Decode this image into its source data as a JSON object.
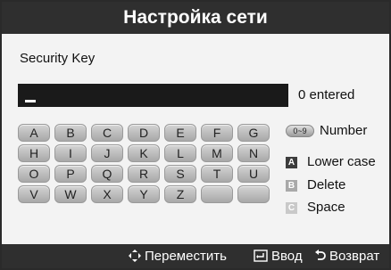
{
  "header": {
    "title": "Настройка сети"
  },
  "field": {
    "label": "Security Key",
    "value": "",
    "entered": "0 entered"
  },
  "keyboard": {
    "rows": [
      [
        "A",
        "B",
        "C",
        "D",
        "E",
        "F",
        "G"
      ],
      [
        "H",
        "I",
        "J",
        "K",
        "L",
        "M",
        "N"
      ],
      [
        "O",
        "P",
        "Q",
        "R",
        "S",
        "T",
        "U"
      ],
      [
        "V",
        "W",
        "X",
        "Y",
        "Z",
        "",
        ""
      ]
    ]
  },
  "legend": {
    "number_pill": "0~9",
    "number": "Number",
    "a_key": "A",
    "lower_case": "Lower case",
    "b_key": "B",
    "delete": "Delete",
    "c_key": "C",
    "space": "Space"
  },
  "footer": {
    "move_icon": "move-arrows-icon",
    "move": "Переместить",
    "enter_icon": "enter-icon",
    "enter": "Ввод",
    "return_icon": "return-icon",
    "return": "Возврат"
  }
}
